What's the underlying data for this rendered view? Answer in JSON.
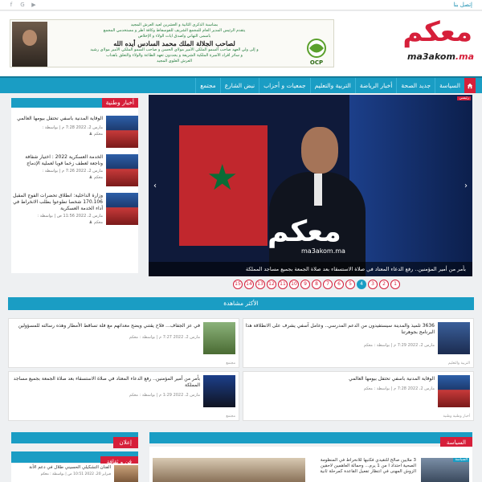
{
  "topbar": {
    "contact_label": "إتصل بنا",
    "social": [
      {
        "icon": "facebook-icon",
        "glyph": "f"
      },
      {
        "icon": "google-plus-icon",
        "glyph": "G"
      },
      {
        "icon": "youtube-icon",
        "glyph": "▶"
      }
    ]
  },
  "header": {
    "logo_arabic": "معكم",
    "logo_latin": "ma3akom",
    "logo_tld": ".ma",
    "banner": {
      "line1": "بمناسبة الذكرى الثانية و العشرين لعيد العرش المجيد",
      "line2": "يتقدم الرئيس المدير العام للمجمع الشريف للفوسفاط وكافة أطر و مستخدمي المجمع",
      "line3": "بأسمى التهاني وأصدق آيات الولاء و الإخلاص",
      "line4": "لصاحب الجلالة الملك محمد السادس أيده الله",
      "line5": "و إلى ولي العهد صاحب السمو الملكي الأمير مولاي الحسن و صاحب السمو الملكي الأمير مولاي رشيد",
      "line6": "و سائر أفراد الأسرة الملكية الشريفة و يجددون تعهد الطاعة والولاء والتعلق بأهداب",
      "line7": "العرش العلوي المجيد",
      "sponsor": "OCP"
    }
  },
  "nav": {
    "items": [
      "السياسة",
      "جديد الصحة",
      "أخبار الرياضة",
      "التربية والتعليم",
      "جمعيات و أحزاب",
      "نبض الشارع",
      "مجتمع"
    ]
  },
  "sidebar": {
    "title": "أخبار وطنية",
    "items": [
      {
        "title": "الوقاية المدنية باسفي تحتفل بيومها العالمي",
        "date": "مارس 2، 2022 7:28 م",
        "by": "بواسطة :",
        "author": "معكم"
      },
      {
        "title": "الخدمة العسكرية 2022 : اختيار شفافة وناجعة لعطف زخما قويا لعملية الإدماج",
        "date": "مارس 2، 2022 7:26 م",
        "by": "بواسطة :",
        "author": "معكم"
      },
      {
        "title": "وزارة الداخلية: انطلاق تحضرات الفوج المقبل 170.106 شخصا تطوعوا بطلب الانخراط في أداء الخدمة العسكرية",
        "date": "مارس 2، 2022 11:56 ص",
        "by": "بواسطة :",
        "author": "معكم"
      }
    ]
  },
  "slider": {
    "tag": "رئيسي",
    "caption": "بأمر من أمير المؤمنين.. رفع الدعاء المعتاد في صلاة الاستسقاء بعد صلاة الجمعة بجميع مساجد المملكة",
    "watermark": "معكم",
    "watermark_latin": "ma3akom.ma",
    "pages": [
      "1",
      "2",
      "3",
      "4",
      "5",
      "6",
      "7",
      "8",
      "9",
      "10",
      "11",
      "12",
      "13",
      "14",
      "15"
    ],
    "active_page": "4"
  },
  "most_viewed": {
    "title": "الأكثر مشاهدة",
    "items": [
      {
        "title": "3636 تلميذ والمدينة سيستفيدون من الدعم المدرسي.. وعامل آسفي يشرف على الانطلاقة هذا البرنامج بجوهرتنا",
        "date": "مارس 2، 2022 7:29 م",
        "by": "بواسطة :",
        "author": "معكم",
        "category": "التربية والتعليم"
      },
      {
        "title": "في عز الجفاف… فلاح يقتني ويضح معداتهم مع فلة تساقط الأمطار وهذه رسالته للمسؤولين",
        "date": "مارس 2، 2022 7:27 م",
        "by": "بواسطة :",
        "author": "معكم",
        "category": "مجتمع"
      },
      {
        "title": "الوقاية المدنية باسفي تحتفل بيومها العالمي",
        "date": "مارس 2، 2022 7:28 م",
        "by": "بواسطة :",
        "author": "معكم",
        "category": "أخبار وطنية وطنية"
      },
      {
        "title": "بأمر من أمير المؤمنين.. رفع الدعاء المعتاد في صلاة الاستسقاء بعد صلاة الجمعة بجميع مساجد المملكة",
        "date": "مارس 2، 2022 1:29 م",
        "by": "بواسطة :",
        "author": "معكم",
        "category": "مجتمع"
      }
    ]
  },
  "bottom": {
    "politics_title": "السياسة",
    "politics_item": "3 ملايين صالح للتقيدي فكتبها للانخراط في المنظومة الصحية احتداد ا من 1 يرم... وحمالة العاهمين لاحقين الزوش المهنى في انتظار تفعيل القاعدة كمرحلة ثانية",
    "politics_tag": "السياسة",
    "ad_title": "إعلان",
    "art_title": "فن و ثقافة",
    "art_item": "الفنان التشكيلي الحسيني طلال في دعم الأنة",
    "art_date": "فبراير 20، 2022 10:51 ص",
    "art_by": "بواسطة :",
    "art_author": "معكم"
  }
}
